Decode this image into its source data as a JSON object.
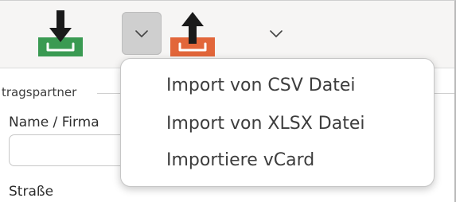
{
  "toolbar": {
    "import_icon": "download-tray-icon",
    "export_icon": "upload-tray-icon",
    "dropdown_icon": "chevron-down-icon",
    "import_color": "#3a9a52",
    "export_color": "#e2663a"
  },
  "form": {
    "group_label": "tragspartner",
    "name_label": "Name / Firma",
    "name_value": "",
    "street_label": "Straße"
  },
  "import_menu": {
    "items": [
      {
        "label": "Import von CSV Datei"
      },
      {
        "label": "Import von XLSX Datei"
      },
      {
        "label": "Importiere vCard"
      }
    ]
  }
}
